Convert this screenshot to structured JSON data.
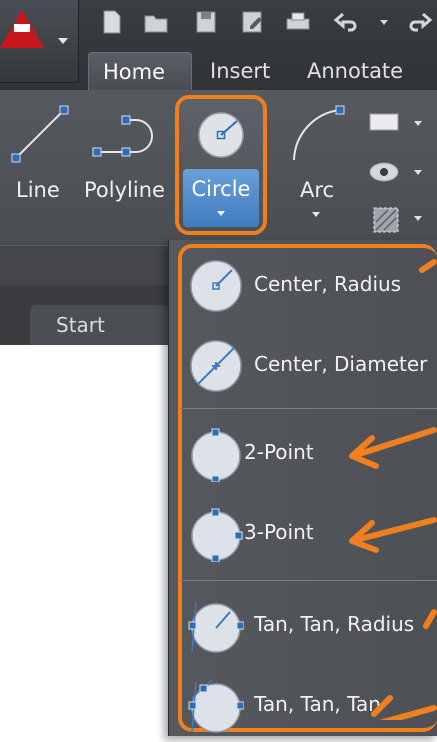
{
  "tabs": [
    {
      "label": "Home",
      "active": true
    },
    {
      "label": "Insert",
      "active": false
    },
    {
      "label": "Annotate",
      "active": false
    }
  ],
  "ribbon": {
    "line_label": "Line",
    "polyline_label": "Polyline",
    "circle_label": "Circle",
    "arc_label": "Arc"
  },
  "file_tab": {
    "label": "Start"
  },
  "circle_menu": {
    "items": [
      {
        "label": "Center, Radius",
        "icon": "circle-center-radius-icon"
      },
      {
        "label": "Center, Diameter",
        "icon": "circle-center-diameter-icon"
      },
      {
        "label": "2-Point",
        "icon": "circle-2-point-icon"
      },
      {
        "label": "3-Point",
        "icon": "circle-3-point-icon"
      },
      {
        "label": "Tan, Tan, Radius",
        "icon": "circle-tan-tan-radius-icon"
      },
      {
        "label": "Tan, Tan, Tan",
        "icon": "circle-tan-tan-tan-icon"
      }
    ]
  },
  "colors": {
    "highlight_orange": "#f07f1f",
    "ribbon_gray": "#4e5156",
    "circle_button_blue": "#4f8cca",
    "app_red": "#c8171c"
  }
}
